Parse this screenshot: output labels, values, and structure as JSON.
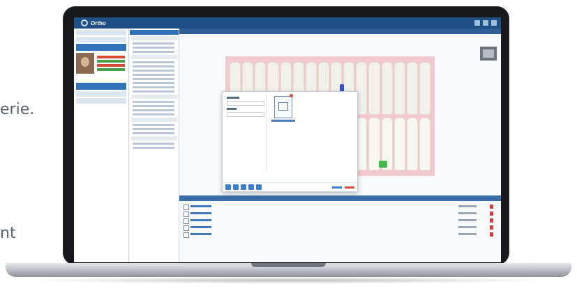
{
  "side_fragments": {
    "fragment_1": "erie.",
    "fragment_2": "nt"
  },
  "app": {
    "logo_text": "Ortho",
    "theme": {
      "primary": "#1f4f84",
      "accent": "#2e73b8",
      "danger": "#d64a3a",
      "success": "#4aa04a",
      "tooth_chart_bg": "#f2c9cf"
    }
  },
  "icons": [
    "app-logo-icon",
    "settings-icon",
    "user-icon",
    "patient-photo",
    "xray-thumbnail",
    "document-file-icon",
    "close-icon",
    "delete-icon"
  ]
}
